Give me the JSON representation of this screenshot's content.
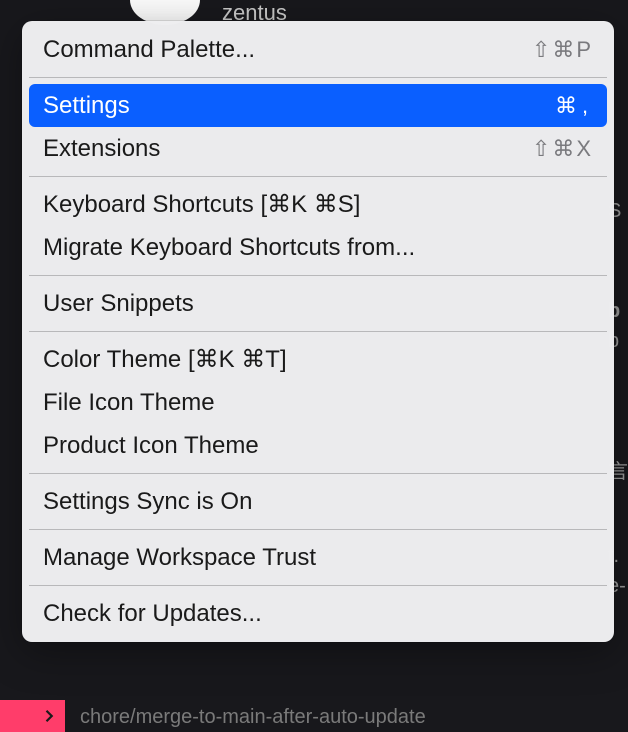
{
  "backdrop": {
    "username": "zentus",
    "bottom_text": "chore/merge-to-main-after-auto-update"
  },
  "menu": {
    "groups": [
      [
        {
          "id": "command-palette",
          "label": "Command Palette...",
          "shortcut": "⇧⌘P",
          "selected": false
        }
      ],
      [
        {
          "id": "settings",
          "label": "Settings",
          "shortcut": "⌘ ,",
          "selected": true
        },
        {
          "id": "extensions",
          "label": "Extensions",
          "shortcut": "⇧⌘X",
          "selected": false
        }
      ],
      [
        {
          "id": "keyboard-shortcuts",
          "label": "Keyboard Shortcuts [⌘K ⌘S]",
          "shortcut": "",
          "selected": false
        },
        {
          "id": "migrate-shortcuts",
          "label": "Migrate Keyboard Shortcuts from...",
          "shortcut": "",
          "selected": false
        }
      ],
      [
        {
          "id": "user-snippets",
          "label": "User Snippets",
          "shortcut": "",
          "selected": false
        }
      ],
      [
        {
          "id": "color-theme",
          "label": "Color Theme [⌘K ⌘T]",
          "shortcut": "",
          "selected": false
        },
        {
          "id": "file-icon-theme",
          "label": "File Icon Theme",
          "shortcut": "",
          "selected": false
        },
        {
          "id": "product-icon-theme",
          "label": "Product Icon Theme",
          "shortcut": "",
          "selected": false
        }
      ],
      [
        {
          "id": "settings-sync",
          "label": "Settings Sync is On",
          "shortcut": "",
          "selected": false
        }
      ],
      [
        {
          "id": "workspace-trust",
          "label": "Manage Workspace Trust",
          "shortcut": "",
          "selected": false
        }
      ],
      [
        {
          "id": "check-updates",
          "label": "Check for Updates...",
          "shortcut": "",
          "selected": false
        }
      ]
    ]
  }
}
